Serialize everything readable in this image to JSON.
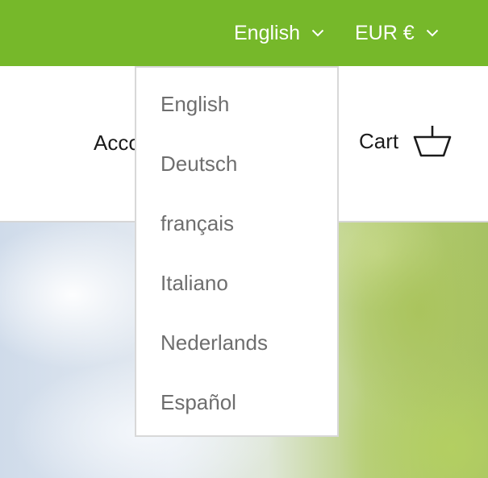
{
  "topbar": {
    "language": "English",
    "currency": "EUR €",
    "background_color": "#76b82a"
  },
  "header": {
    "account_label": "Acco",
    "cart_label": "Cart",
    "cart_icon": "basket-icon"
  },
  "language_dropdown": {
    "options": [
      "English",
      "Deutsch",
      "français",
      "Italiano",
      "Nederlands",
      "Español"
    ]
  }
}
